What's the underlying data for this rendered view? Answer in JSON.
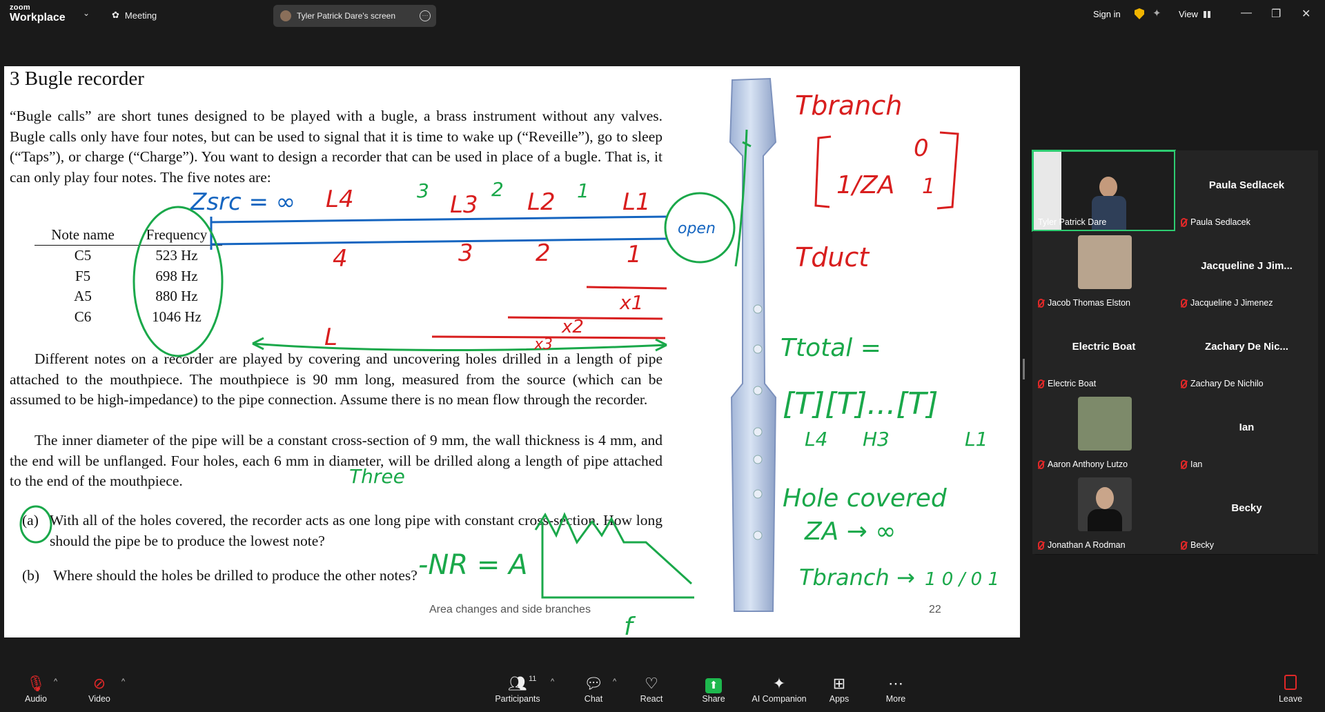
{
  "app": {
    "brand_line1": "zoom",
    "brand_line2": "Workplace",
    "meeting_label": "Meeting",
    "share_label": "Tyler Patrick Dare's screen",
    "sign_in": "Sign in",
    "view": "View"
  },
  "slide": {
    "heading": "3   Bugle recorder",
    "para1": "“Bugle calls” are short tunes designed to be played with a bugle, a brass instrument without any valves. Bugle calls only have four notes, but can be used to signal that it is time to wake up (“Reveille”), go to sleep (“Taps”), or charge (“Charge”). You want to design a recorder that can be used in place of a bugle. That is, it can only play four notes. The five notes are:",
    "table": {
      "headers": [
        "Note name",
        "Frequency"
      ],
      "rows": [
        [
          "C5",
          "523 Hz"
        ],
        [
          "F5",
          "698 Hz"
        ],
        [
          "A5",
          "880 Hz"
        ],
        [
          "C6",
          "1046 Hz"
        ]
      ]
    },
    "para2": "Different notes on a recorder are played by covering and uncovering holes drilled in a length of pipe attached to the mouthpiece. The mouthpiece is 90 mm long, measured from the source (which can be assumed to be high-impedance) to the pipe connection. Assume there is no mean flow through the recorder.",
    "para3": "The inner diameter of the pipe will be a constant cross-section of 9 mm, the wall thickness is 4 mm, and the end will be unflanged. Four holes, each 6 mm in diameter, will be drilled along a length of pipe attached to the end of the mouthpiece.",
    "qa": {
      "label": "(a)",
      "text": "With all of the holes covered, the recorder acts as one long pipe with constant cross-section. How long should the pipe be to produce the lowest note?"
    },
    "qb": {
      "label": "(b)",
      "text": "Where should the holes be drilled to produce the other notes?"
    },
    "footer": "Area changes and side branches",
    "page_number": "22",
    "ink_notes": {
      "zsrc": "Zsrc = ∞",
      "L4": "L4",
      "L3": "L3",
      "L2": "L2",
      "L1": "L1",
      "n3": "3",
      "n2": "2",
      "n1": "1",
      "open": "open",
      "seg4": "4",
      "seg3": "3",
      "seg2": "2",
      "seg1": "1",
      "x1": "x1",
      "x2": "x2",
      "x3": "x3",
      "L": "L",
      "three": "Three",
      "nr": "-NR = A",
      "f": "f",
      "tbranch": "Tbranch",
      "za": "1/ZA",
      "m0": "0",
      "m1": "1",
      "tduct": "Tduct",
      "ttotal": "Ttotal =",
      "tchain": "[T][T]...[T]",
      "sub4": "L4",
      "subh3": "H3",
      "sub1": "L1",
      "hole_covered": "Hole covered",
      "za_inf": "ZA → ∞",
      "tbranch_to": "Tbranch →",
      "identity": "1 0 / 0 1"
    }
  },
  "participants": [
    {
      "name": "Tyler Patrick Dare",
      "display": "",
      "video": true,
      "active": true
    },
    {
      "name": "Paula Sedlacek",
      "display": "Paula Sedlacek",
      "video": false
    },
    {
      "name": "Jacob Thomas Elston",
      "display": "",
      "video": true
    },
    {
      "name": "Jacqueline J Jimenez",
      "display": "Jacqueline J Jim...",
      "video": false
    },
    {
      "name": "Electric Boat",
      "display": "Electric Boat",
      "video": false
    },
    {
      "name": "Zachary De Nichilo",
      "display": "Zachary De Nic...",
      "video": false
    },
    {
      "name": "Aaron Anthony Lutzo",
      "display": "",
      "video": true
    },
    {
      "name": "Ian",
      "display": "Ian",
      "video": false
    },
    {
      "name": "Jonathan A Rodman",
      "display": "",
      "video": true
    },
    {
      "name": "Becky",
      "display": "Becky",
      "video": false
    }
  ],
  "toolbar": {
    "audio": "Audio",
    "video": "Video",
    "participants": "Participants",
    "participant_count": "11",
    "chat": "Chat",
    "react": "React",
    "share": "Share",
    "ai": "AI Companion",
    "apps": "Apps",
    "more": "More",
    "leave": "Leave"
  },
  "colors": {
    "ink_red": "#d81e1e",
    "ink_blue": "#1565c0",
    "ink_green": "#1aa84a",
    "share_green": "#1eb84e"
  }
}
